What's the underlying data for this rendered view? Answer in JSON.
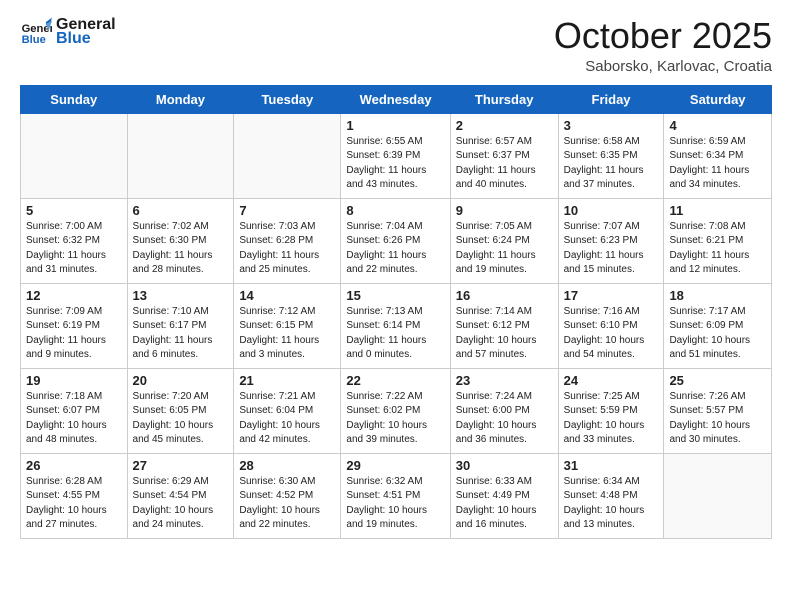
{
  "header": {
    "logo_line1": "General",
    "logo_line2": "Blue",
    "month_title": "October 2025",
    "location": "Saborsko, Karlovac, Croatia"
  },
  "weekdays": [
    "Sunday",
    "Monday",
    "Tuesday",
    "Wednesday",
    "Thursday",
    "Friday",
    "Saturday"
  ],
  "weeks": [
    [
      {
        "day": "",
        "info": ""
      },
      {
        "day": "",
        "info": ""
      },
      {
        "day": "",
        "info": ""
      },
      {
        "day": "1",
        "info": "Sunrise: 6:55 AM\nSunset: 6:39 PM\nDaylight: 11 hours\nand 43 minutes."
      },
      {
        "day": "2",
        "info": "Sunrise: 6:57 AM\nSunset: 6:37 PM\nDaylight: 11 hours\nand 40 minutes."
      },
      {
        "day": "3",
        "info": "Sunrise: 6:58 AM\nSunset: 6:35 PM\nDaylight: 11 hours\nand 37 minutes."
      },
      {
        "day": "4",
        "info": "Sunrise: 6:59 AM\nSunset: 6:34 PM\nDaylight: 11 hours\nand 34 minutes."
      }
    ],
    [
      {
        "day": "5",
        "info": "Sunrise: 7:00 AM\nSunset: 6:32 PM\nDaylight: 11 hours\nand 31 minutes."
      },
      {
        "day": "6",
        "info": "Sunrise: 7:02 AM\nSunset: 6:30 PM\nDaylight: 11 hours\nand 28 minutes."
      },
      {
        "day": "7",
        "info": "Sunrise: 7:03 AM\nSunset: 6:28 PM\nDaylight: 11 hours\nand 25 minutes."
      },
      {
        "day": "8",
        "info": "Sunrise: 7:04 AM\nSunset: 6:26 PM\nDaylight: 11 hours\nand 22 minutes."
      },
      {
        "day": "9",
        "info": "Sunrise: 7:05 AM\nSunset: 6:24 PM\nDaylight: 11 hours\nand 19 minutes."
      },
      {
        "day": "10",
        "info": "Sunrise: 7:07 AM\nSunset: 6:23 PM\nDaylight: 11 hours\nand 15 minutes."
      },
      {
        "day": "11",
        "info": "Sunrise: 7:08 AM\nSunset: 6:21 PM\nDaylight: 11 hours\nand 12 minutes."
      }
    ],
    [
      {
        "day": "12",
        "info": "Sunrise: 7:09 AM\nSunset: 6:19 PM\nDaylight: 11 hours\nand 9 minutes."
      },
      {
        "day": "13",
        "info": "Sunrise: 7:10 AM\nSunset: 6:17 PM\nDaylight: 11 hours\nand 6 minutes."
      },
      {
        "day": "14",
        "info": "Sunrise: 7:12 AM\nSunset: 6:15 PM\nDaylight: 11 hours\nand 3 minutes."
      },
      {
        "day": "15",
        "info": "Sunrise: 7:13 AM\nSunset: 6:14 PM\nDaylight: 11 hours\nand 0 minutes."
      },
      {
        "day": "16",
        "info": "Sunrise: 7:14 AM\nSunset: 6:12 PM\nDaylight: 10 hours\nand 57 minutes."
      },
      {
        "day": "17",
        "info": "Sunrise: 7:16 AM\nSunset: 6:10 PM\nDaylight: 10 hours\nand 54 minutes."
      },
      {
        "day": "18",
        "info": "Sunrise: 7:17 AM\nSunset: 6:09 PM\nDaylight: 10 hours\nand 51 minutes."
      }
    ],
    [
      {
        "day": "19",
        "info": "Sunrise: 7:18 AM\nSunset: 6:07 PM\nDaylight: 10 hours\nand 48 minutes."
      },
      {
        "day": "20",
        "info": "Sunrise: 7:20 AM\nSunset: 6:05 PM\nDaylight: 10 hours\nand 45 minutes."
      },
      {
        "day": "21",
        "info": "Sunrise: 7:21 AM\nSunset: 6:04 PM\nDaylight: 10 hours\nand 42 minutes."
      },
      {
        "day": "22",
        "info": "Sunrise: 7:22 AM\nSunset: 6:02 PM\nDaylight: 10 hours\nand 39 minutes."
      },
      {
        "day": "23",
        "info": "Sunrise: 7:24 AM\nSunset: 6:00 PM\nDaylight: 10 hours\nand 36 minutes."
      },
      {
        "day": "24",
        "info": "Sunrise: 7:25 AM\nSunset: 5:59 PM\nDaylight: 10 hours\nand 33 minutes."
      },
      {
        "day": "25",
        "info": "Sunrise: 7:26 AM\nSunset: 5:57 PM\nDaylight: 10 hours\nand 30 minutes."
      }
    ],
    [
      {
        "day": "26",
        "info": "Sunrise: 6:28 AM\nSunset: 4:55 PM\nDaylight: 10 hours\nand 27 minutes."
      },
      {
        "day": "27",
        "info": "Sunrise: 6:29 AM\nSunset: 4:54 PM\nDaylight: 10 hours\nand 24 minutes."
      },
      {
        "day": "28",
        "info": "Sunrise: 6:30 AM\nSunset: 4:52 PM\nDaylight: 10 hours\nand 22 minutes."
      },
      {
        "day": "29",
        "info": "Sunrise: 6:32 AM\nSunset: 4:51 PM\nDaylight: 10 hours\nand 19 minutes."
      },
      {
        "day": "30",
        "info": "Sunrise: 6:33 AM\nSunset: 4:49 PM\nDaylight: 10 hours\nand 16 minutes."
      },
      {
        "day": "31",
        "info": "Sunrise: 6:34 AM\nSunset: 4:48 PM\nDaylight: 10 hours\nand 13 minutes."
      },
      {
        "day": "",
        "info": ""
      }
    ]
  ]
}
